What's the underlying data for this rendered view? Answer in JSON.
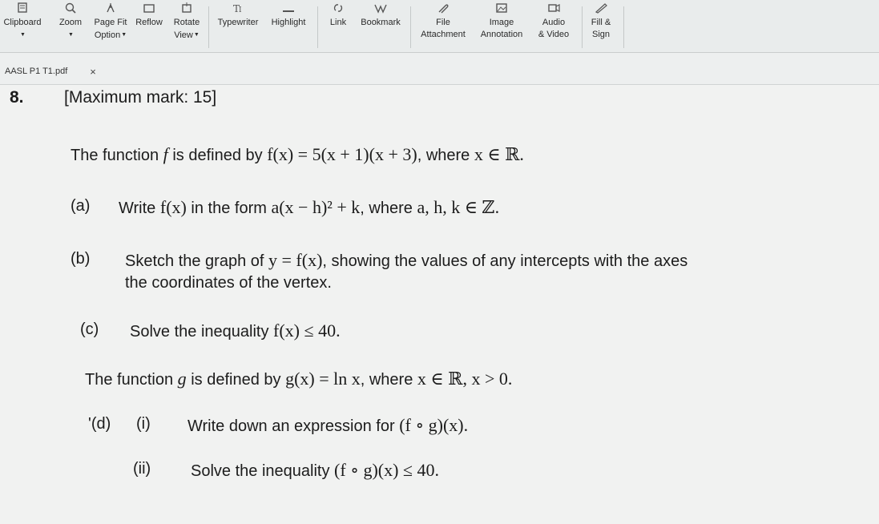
{
  "toolbar": {
    "tools": [
      {
        "name": "clipboard",
        "label": "Clipboard",
        "sub": "",
        "icon": "clipboard-icon"
      },
      {
        "name": "zoom",
        "label": "Zoom",
        "sub": "",
        "icon": "zoom-icon"
      },
      {
        "name": "page-fit",
        "label": "Page Fit",
        "sub": "Option",
        "icon": "page-fit-icon"
      },
      {
        "name": "reflow",
        "label": "Reflow",
        "sub": "",
        "icon": "reflow-icon"
      },
      {
        "name": "rotate",
        "label": "Rotate",
        "sub": "View",
        "icon": "rotate-icon"
      },
      {
        "name": "typewriter",
        "label": "Typewriter",
        "sub": "",
        "icon": "typewriter-icon"
      },
      {
        "name": "highlight",
        "label": "Highlight",
        "sub": "",
        "icon": "highlight-icon"
      },
      {
        "name": "link",
        "label": "Link",
        "sub": "",
        "icon": "link-icon"
      },
      {
        "name": "bookmark",
        "label": "Bookmark",
        "sub": "",
        "icon": "bookmark-icon"
      },
      {
        "name": "file-attachment",
        "label": "File",
        "sub": "Attachment",
        "icon": "file-attachment-icon"
      },
      {
        "name": "image-annotation",
        "label": "Image",
        "sub": "Annotation",
        "icon": "image-icon"
      },
      {
        "name": "audio-video",
        "label": "Audio",
        "sub": "& Video",
        "icon": "audio-video-icon"
      },
      {
        "name": "fill-sign",
        "label": "Fill &",
        "sub": "Sign",
        "icon": "fill-sign-icon"
      }
    ]
  },
  "tab": {
    "filename": "AASL P1 T1.pdf",
    "close": "×"
  },
  "document": {
    "q_number": "8.",
    "q_marks": "[Maximum mark: 15]",
    "intro_prefix": "The function",
    "intro_f": "f",
    "intro_mid": "is defined by",
    "intro_fx": "f(x) = 5(x + 1)(x + 3)",
    "intro_where": ", where",
    "intro_domain": "x ∈ ℝ.",
    "a_label": "(a)",
    "a_prefix": "Write",
    "a_fx": "f(x)",
    "a_mid": "in the form",
    "a_form": "a(x − h)² + k",
    "a_where": ", where",
    "a_vars": "a, h, k ∈ ℤ.",
    "b_label": "(b)",
    "b_prefix": "Sketch the graph of",
    "b_eq": "y = f(x)",
    "b_rest": ", showing the values of any intercepts with the axes",
    "b_line2": "the coordinates of the vertex.",
    "c_label": "(c)",
    "c_prefix": "Solve the inequality",
    "c_ineq": "f(x) ≤ 40.",
    "g_prefix": "The function",
    "g_g": "g",
    "g_mid": "is defined by",
    "g_def": "g(x) = ln x",
    "g_where": ", where",
    "g_domain": "x ∈ ℝ, x > 0.",
    "d_label": "'(d)",
    "d_i": "(i)",
    "d_i_text": "Write down an expression for",
    "d_i_expr": "(f ∘ g)(x).",
    "d_ii": "(ii)",
    "d_ii_text": "Solve the inequality",
    "d_ii_expr": "(f ∘ g)(x) ≤ 40."
  }
}
